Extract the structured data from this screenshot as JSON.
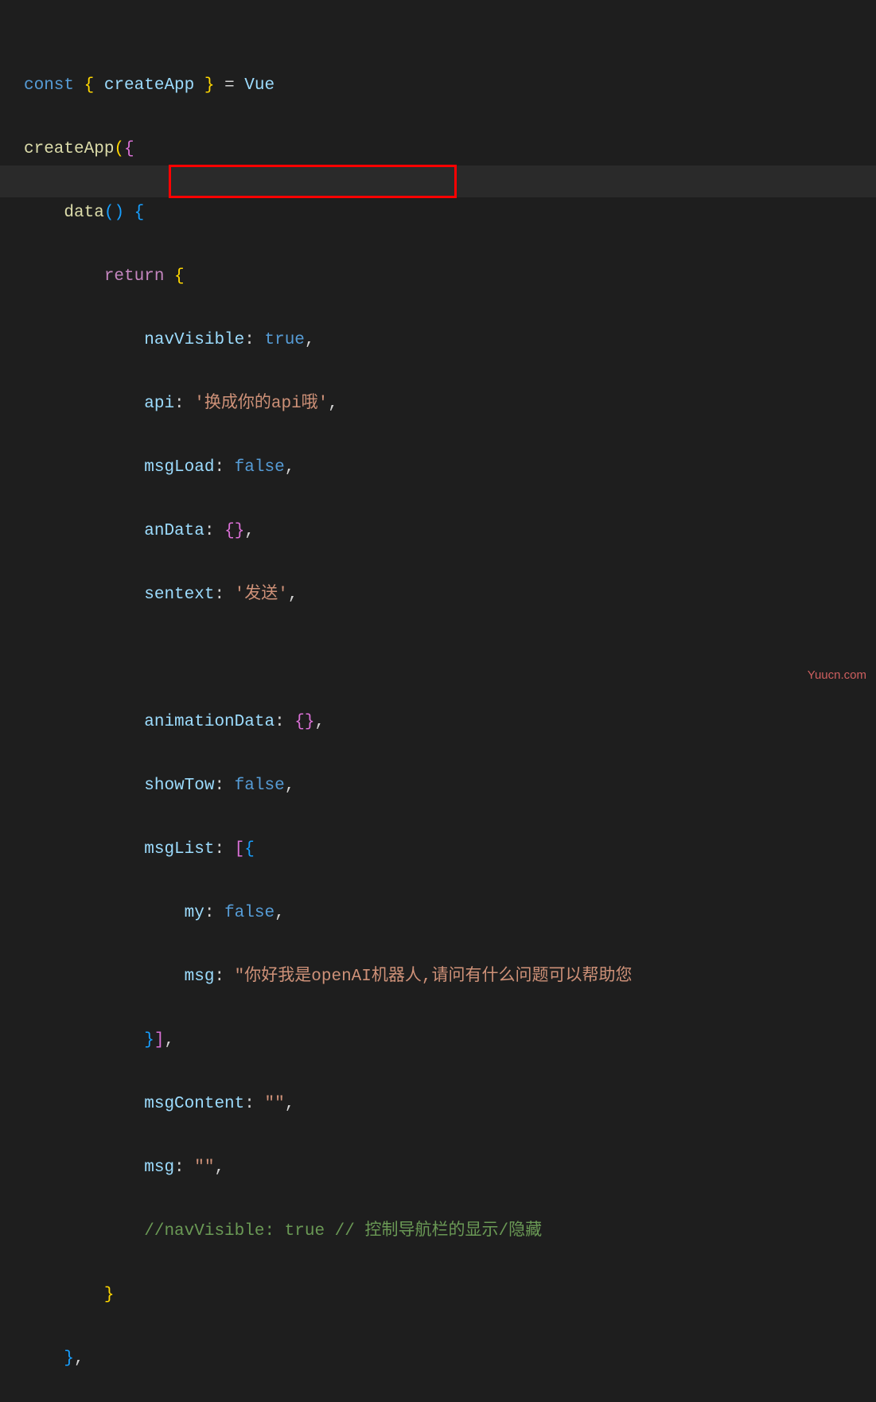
{
  "code": {
    "l1_const": "const",
    "l1_brace_open": "{",
    "l1_createApp": "createApp",
    "l1_brace_close": "}",
    "l1_eq": " = ",
    "l1_vue": "Vue",
    "l2_createApp": "createApp",
    "l2_paren": "(",
    "l2_brace": "{",
    "l3_data": "data",
    "l3_parens": "()",
    "l3_brace": " {",
    "l4_return": "return",
    "l4_brace": " {",
    "l5_prop": "navVisible",
    "l5_colon": ": ",
    "l5_val": "true",
    "l5_comma": ",",
    "l6_prop": "api",
    "l6_colon": ": ",
    "l6_val": "'换成你的api哦'",
    "l6_comma": ",",
    "l7_prop": "msgLoad",
    "l7_colon": ": ",
    "l7_val": "false",
    "l7_comma": ",",
    "l8_prop": "anData",
    "l8_colon": ": ",
    "l8_val_open": "{",
    "l8_val_close": "}",
    "l8_comma": ",",
    "l9_prop": "sentext",
    "l9_colon": ": ",
    "l9_val": "'发送'",
    "l9_comma": ",",
    "l11_prop": "animationData",
    "l11_colon": ": ",
    "l11_val_open": "{",
    "l11_val_close": "}",
    "l11_comma": ",",
    "l12_prop": "showTow",
    "l12_colon": ": ",
    "l12_val": "false",
    "l12_comma": ",",
    "l13_prop": "msgList",
    "l13_colon": ": ",
    "l13_bracket": "[",
    "l13_brace": "{",
    "l14_prop": "my",
    "l14_colon": ": ",
    "l14_val": "false",
    "l14_comma": ",",
    "l15_prop": "msg",
    "l15_colon": ": ",
    "l15_val": "\"你好我是openAI机器人,请问有什么问题可以帮助您",
    "l16_brace": "}",
    "l16_bracket": "]",
    "l16_comma": ",",
    "l17_prop": "msgContent",
    "l17_colon": ": ",
    "l17_val": "\"\"",
    "l17_comma": ",",
    "l18_prop": "msg",
    "l18_colon": ": ",
    "l18_val": "\"\"",
    "l18_comma": ",",
    "l19_comment": "//navVisible: true // 控制导航栏的显示/隐藏",
    "l20_brace": "}",
    "l21_brace": "}",
    "l21_comma": ","
  },
  "watermark": "Yuucn.com"
}
